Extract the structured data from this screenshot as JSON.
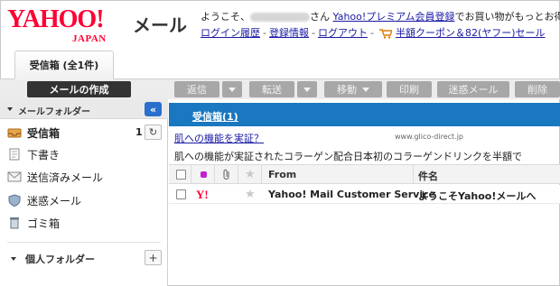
{
  "brand": {
    "logo_main": "YAHOO!",
    "logo_sub": "JAPAN",
    "service": "メール"
  },
  "header": {
    "greeting_prefix": "ようこそ、",
    "greeting_suffix": "さん",
    "premium_link": "Yahoo!プレミアム会員登録",
    "premium_suffix": "でお買い物がもっとお得に",
    "login_history": "ログイン履歴",
    "sep": "-",
    "account_info": "登録情報",
    "logout": "ログアウト",
    "coupon_link": "半額クーポン＆82(ヤフー)セール"
  },
  "tabs": [
    {
      "label": "受信箱 (全1件)"
    }
  ],
  "toolbar": {
    "compose": "メールの作成",
    "reply": "返信",
    "forward": "転送",
    "move": "移動",
    "print": "印刷",
    "spam": "迷惑メール",
    "delete": "削除"
  },
  "sidebar": {
    "folders_header": "メールフォルダー",
    "collapse_glyph": "«",
    "items": [
      {
        "label": "受信箱",
        "count": "1",
        "icon": "inbox-icon"
      },
      {
        "label": "下書き",
        "icon": "draft-icon"
      },
      {
        "label": "送信済みメール",
        "icon": "sent-icon"
      },
      {
        "label": "迷惑メール",
        "icon": "shield-icon"
      },
      {
        "label": "ゴミ箱",
        "icon": "trash-icon"
      }
    ],
    "personal_header": "個人フォルダー",
    "add_glyph": "+"
  },
  "main": {
    "title": "受信箱(1)",
    "ad": {
      "headline": "肌への機能を実証？",
      "source": "www.glico-direct.jp",
      "text": "肌への機能が実証されたコラーゲン配合日本初のコラーゲンドリンクを半額で"
    },
    "columns": {
      "from": "From",
      "subject": "件名"
    },
    "rows": [
      {
        "from": "Yahoo! Mail Customer Service",
        "subject": "ようこそYahoo!メールへ",
        "sender_logo": "Y!"
      }
    ]
  },
  "colors": {
    "brand_red": "#ff0033",
    "accent_blue": "#1a78c0",
    "compose_bg": "#333333"
  }
}
